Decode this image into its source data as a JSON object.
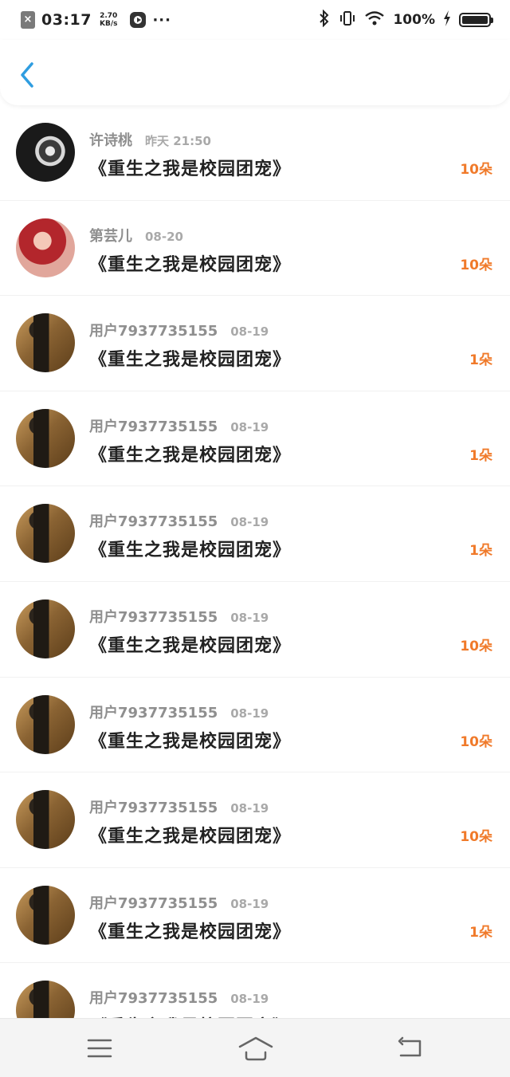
{
  "status_bar": {
    "time": "03:17",
    "speed_value": "2.70",
    "speed_unit": "KB/s",
    "battery": "100%",
    "more": "···"
  },
  "records": [
    {
      "name": "许诗桃",
      "date": "昨天 21:50",
      "title": "《重生之我是校园团宠》",
      "amount": "10朵",
      "avatar": "cat-avatar"
    },
    {
      "name": "第芸儿",
      "date": "08-20",
      "title": "《重生之我是校园团宠》",
      "amount": "10朵",
      "avatar": "girl-avatar"
    },
    {
      "name": "用户7937735155",
      "date": "08-19",
      "title": "《重生之我是校园团宠》",
      "amount": "1朵",
      "avatar": "user-avatar"
    },
    {
      "name": "用户7937735155",
      "date": "08-19",
      "title": "《重生之我是校园团宠》",
      "amount": "1朵",
      "avatar": "user-avatar"
    },
    {
      "name": "用户7937735155",
      "date": "08-19",
      "title": "《重生之我是校园团宠》",
      "amount": "1朵",
      "avatar": "user-avatar"
    },
    {
      "name": "用户7937735155",
      "date": "08-19",
      "title": "《重生之我是校园团宠》",
      "amount": "10朵",
      "avatar": "user-avatar"
    },
    {
      "name": "用户7937735155",
      "date": "08-19",
      "title": "《重生之我是校园团宠》",
      "amount": "10朵",
      "avatar": "user-avatar"
    },
    {
      "name": "用户7937735155",
      "date": "08-19",
      "title": "《重生之我是校园团宠》",
      "amount": "10朵",
      "avatar": "user-avatar"
    },
    {
      "name": "用户7937735155",
      "date": "08-19",
      "title": "《重生之我是校园团宠》",
      "amount": "1朵",
      "avatar": "user-avatar"
    },
    {
      "name": "用户7937735155",
      "date": "08-19",
      "title": "《重生之我是校园团宠》",
      "amount": "",
      "avatar": "user-avatar"
    }
  ],
  "colors": {
    "accent_blue": "#2f9de0",
    "amount_orange": "#f07a2a",
    "name_gray": "#8f8f8f",
    "title_dark": "#222222"
  },
  "icons": {
    "back": "chevron-left-icon",
    "menu": "menu-icon",
    "home": "home-icon",
    "return": "back-arrow-icon"
  }
}
